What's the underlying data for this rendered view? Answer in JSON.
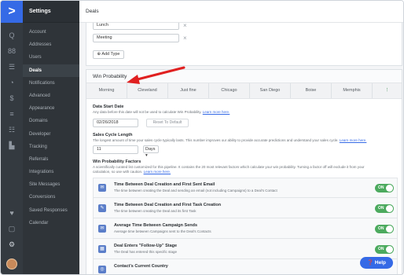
{
  "rail": {
    "logo": ">",
    "icons": [
      "Q",
      "88",
      "☰",
      "◔",
      "$",
      "≡",
      "☷",
      "▙"
    ],
    "bottom_icons": [
      "♥",
      "▢",
      "⚙"
    ]
  },
  "sidebar": {
    "title": "Settings",
    "items": [
      "Account",
      "Addresses",
      "Users",
      "Deals",
      "Notifications",
      "Advanced",
      "Appearance",
      "Domains",
      "Developer",
      "Tracking",
      "Referrals",
      "Integrations",
      "Site Messages",
      "Conversions",
      "Saved Responses",
      "Calendar"
    ],
    "active_index": 3
  },
  "topbar": {
    "title": "Deals"
  },
  "deal_types": {
    "values": [
      "Lunch",
      "Meeting"
    ],
    "remove_icon": "×",
    "add_button": "⊕ Add Type"
  },
  "win_probability": {
    "title": "Win Probability",
    "tabs": [
      "Morning",
      "Cleveland",
      "Just fine",
      "Chicago",
      "San Diego",
      "Boise",
      "Memphis",
      "⋮"
    ],
    "data_start_date": {
      "label": "Data Start Date",
      "help": "Any data before this date will not be used to calculate Win Probability.",
      "help_link": "Learn more here.",
      "value": "02/26/2018",
      "reset_button": "Reset To Default"
    },
    "sales_cycle": {
      "label": "Sales Cycle Length",
      "help": "The longest amount of time your sales cycle typically lasts. This number improves our ability to provide accurate predictions and understand your sales cycle.",
      "help_link": "Learn more here.",
      "value": "11",
      "unit": "Days ▾"
    },
    "factors": {
      "label": "Win Probability Factors",
      "help": "A scientifically curated list customized for this pipeline. It contains the 20 most relevant factors which calculate your win probability. Turning a factor off will exclude it from your",
      "help2": "calculation, so use with caution.",
      "help_link": "Learn more here.",
      "items": [
        {
          "title": "Time Between Deal Creation and First Sent Email",
          "desc": "The time between creating the Deal and sending an email (not including Campaigns) to a Deal's Contact",
          "toggle": "ON"
        },
        {
          "title": "Time Between Deal Creation and First Task Creation",
          "desc": "The time between creating the Deal and its first Task",
          "toggle": "ON"
        },
        {
          "title": "Average Time Between Campaign Sends",
          "desc": "Average time between Campaigns sent to the Deal's Contacts",
          "toggle": "ON"
        },
        {
          "title": "Deal Enters \"Follow-Up\" Stage",
          "desc": "The Deal has entered this specific stage",
          "toggle": "ON"
        },
        {
          "title": "Contact's Current Country",
          "desc": "",
          "toggle": ""
        }
      ]
    }
  },
  "help_button": "❓ Help",
  "colors": {
    "accent": "#356ae6",
    "toggle_on": "#4caa5e",
    "arrow": "#e02020",
    "sidebar": "#2f3439"
  }
}
